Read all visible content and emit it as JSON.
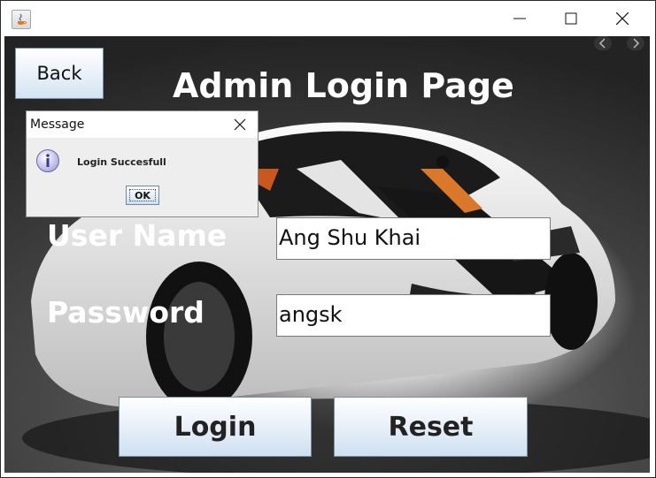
{
  "window": {
    "controls": {
      "minimize": "minimize-icon",
      "maximize": "maximize-icon",
      "close": "close-icon"
    }
  },
  "page": {
    "back_label": "Back",
    "title": "Admin Login Page",
    "username_label": "User Name",
    "username_value": "Ang Shu Khai",
    "password_label": "Password",
    "password_value": "angsk",
    "login_label": "Login",
    "reset_label": "Reset"
  },
  "dialog": {
    "title": "Message",
    "message": "Login Succesfull",
    "ok_label": "OK",
    "icon": "info-icon"
  },
  "colors": {
    "title_text": "#ffffff",
    "button_gradient_top": "#ffffff",
    "button_gradient_bottom": "#cfe0f0",
    "button_border": "#7a8ea3"
  }
}
